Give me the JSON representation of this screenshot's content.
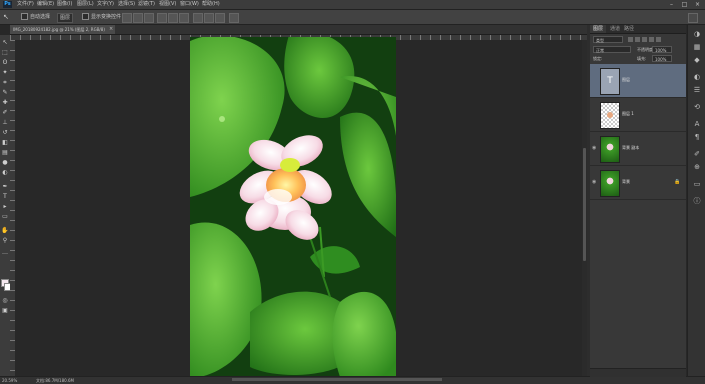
{
  "app": {
    "logo": "Ps"
  },
  "menu": [
    "文件(F)",
    "编辑(E)",
    "图像(I)",
    "图层(L)",
    "文字(Y)",
    "选择(S)",
    "滤镜(T)",
    "视图(V)",
    "窗口(W)",
    "帮助(H)"
  ],
  "window_controls": {
    "minimize": "–",
    "maximize": "□",
    "close": "×"
  },
  "options": {
    "tool_glyph": "↖",
    "auto_select_label": "自动选择",
    "auto_select_target": "图层",
    "show_transform_label": "显示变换控件"
  },
  "document": {
    "tab_title": "IMG_20180924182.jpg @ 21% (图层 2, RGB/8)",
    "close": "×"
  },
  "status": {
    "zoom": "20.59%",
    "doc_size": "文档:86.7M/180.6M"
  },
  "layers_panel": {
    "tabs": [
      "图层",
      "通道",
      "路径"
    ],
    "kind_filter": "类型",
    "blend_mode": "正常",
    "opacity_label": "不透明度:",
    "opacity_value": "100%",
    "lock_label": "锁定:",
    "fill_label": "填充:",
    "fill_value": "100%",
    "layers": [
      {
        "name": "图层",
        "type": "text",
        "selected": true,
        "visible": false
      },
      {
        "name": "图层 1",
        "type": "transparent",
        "selected": false,
        "visible": false
      },
      {
        "name": "背景 副本",
        "type": "photo",
        "selected": false,
        "visible": true
      },
      {
        "name": "背景",
        "type": "photo",
        "selected": false,
        "visible": true,
        "locked": true
      }
    ]
  },
  "colors": {
    "foreground": "#f6e9f0",
    "background": "#ffffff",
    "selection": "#5f6c7f"
  }
}
